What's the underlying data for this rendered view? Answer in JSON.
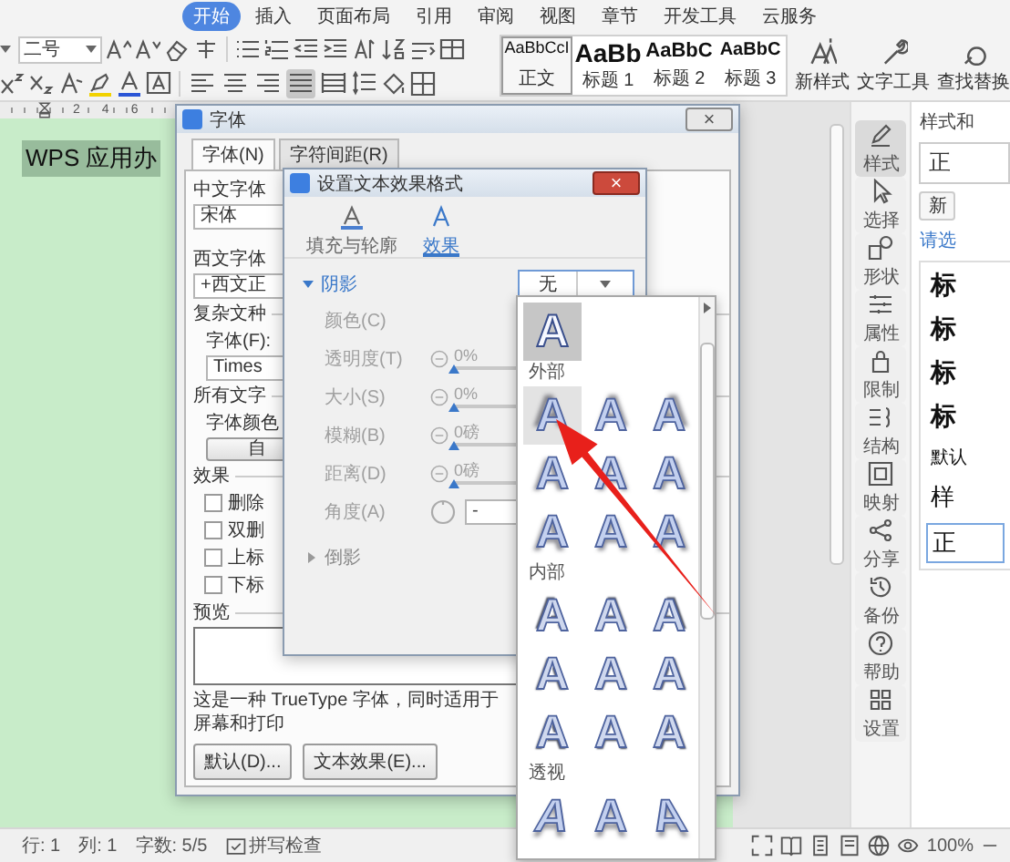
{
  "ribbon": {
    "tabs": [
      {
        "label": "开始",
        "selected": true
      },
      {
        "label": "插入",
        "selected": false
      },
      {
        "label": "页面布局",
        "selected": false
      },
      {
        "label": "引用",
        "selected": false
      },
      {
        "label": "审阅",
        "selected": false
      },
      {
        "label": "视图",
        "selected": false
      },
      {
        "label": "章节",
        "selected": false
      },
      {
        "label": "开发工具",
        "selected": false
      },
      {
        "label": "云服务",
        "selected": false
      }
    ],
    "font_size": "二号",
    "align_buttons": [
      {
        "selected": false
      },
      {
        "selected": false
      },
      {
        "selected": false
      },
      {
        "selected": true
      },
      {
        "selected": false
      }
    ],
    "styles": [
      {
        "sample": "AaBbCcI",
        "name": "正文",
        "kind": "normal",
        "selected": true
      },
      {
        "sample": "AaBb",
        "name": "标题 1",
        "kind": "heading1",
        "selected": false
      },
      {
        "sample": "AaBbC",
        "name": "标题 2",
        "kind": "heading2",
        "selected": false
      },
      {
        "sample": "AaBbC",
        "name": "标题 3",
        "kind": "heading3",
        "selected": false
      }
    ],
    "commands": [
      {
        "label": "新样式"
      },
      {
        "label": "文字工具"
      },
      {
        "label": "查找替换"
      }
    ]
  },
  "ruler": {
    "marks": [
      "2",
      "4",
      "6"
    ]
  },
  "document": {
    "text": "WPS 应用办",
    "selected": true
  },
  "font_dialog": {
    "title": "字体",
    "tabs": [
      {
        "label": "字体(N)",
        "selected": true
      },
      {
        "label": "字符间距(R)",
        "selected": false
      }
    ],
    "chinese_font": {
      "label": "中文字体",
      "value": "宋体"
    },
    "western_font": {
      "label": "西文字体",
      "value": "+西文正"
    },
    "complex_script": {
      "label": "复杂文种",
      "font_label": "字体(F):",
      "value": "Times"
    },
    "all_text": {
      "label": "所有文字",
      "color_label": "字体颜色",
      "color_button": "自"
    },
    "effects": {
      "label": "效果",
      "options": [
        {
          "label": "删除",
          "checked": false
        },
        {
          "label": "双删",
          "checked": false
        },
        {
          "label": "上标",
          "checked": false
        },
        {
          "label": "下标",
          "checked": false
        }
      ]
    },
    "preview_label": "预览",
    "description": "这是一种 TrueType 字体，同时适用于屏幕和打印",
    "buttons": [
      "默认(D)...",
      "文本效果(E)..."
    ]
  },
  "effect_dialog": {
    "title": "设置文本效果格式",
    "tabs": [
      {
        "label": "填充与轮廓",
        "selected": false
      },
      {
        "label": "效果",
        "selected": true
      }
    ],
    "shadow": {
      "label": "阴影",
      "expanded": true,
      "preset": "无",
      "rows": [
        {
          "kind": "color",
          "label": "颜色(C)",
          "disabled": true
        },
        {
          "kind": "slider",
          "label": "透明度(T)",
          "reading": "0%",
          "level": 0,
          "disabled": true
        },
        {
          "kind": "slider",
          "label": "大小(S)",
          "reading": "0%",
          "level": 0,
          "disabled": true
        },
        {
          "kind": "slider",
          "label": "模糊(B)",
          "reading": "0磅",
          "level": 0,
          "disabled": true
        },
        {
          "kind": "slider",
          "label": "距离(D)",
          "reading": "0磅",
          "level": 0,
          "disabled": true
        },
        {
          "kind": "angle",
          "label": "角度(A)",
          "value": "-",
          "disabled": true
        }
      ]
    },
    "reflection": {
      "label": "倒影",
      "expanded": false
    }
  },
  "shadow_menu": {
    "none": {
      "sample": "A",
      "selected": true
    },
    "groups": [
      {
        "heading": "外部",
        "kind": "outer",
        "presets": [
          {
            "sample": "A",
            "selected": false,
            "hovered": true
          },
          {
            "sample": "A",
            "selected": false,
            "hovered": false
          },
          {
            "sample": "A",
            "selected": false,
            "hovered": false
          },
          {
            "sample": "A",
            "selected": false,
            "hovered": false
          },
          {
            "sample": "A",
            "selected": false,
            "hovered": false
          },
          {
            "sample": "A",
            "selected": false,
            "hovered": false
          },
          {
            "sample": "A",
            "selected": false,
            "hovered": false
          },
          {
            "sample": "A",
            "selected": false,
            "hovered": false
          },
          {
            "sample": "A",
            "selected": false,
            "hovered": false
          }
        ]
      },
      {
        "heading": "内部",
        "kind": "inner",
        "presets": [
          {
            "sample": "A",
            "selected": false,
            "hovered": false
          },
          {
            "sample": "A",
            "selected": false,
            "hovered": false
          },
          {
            "sample": "A",
            "selected": false,
            "hovered": false
          },
          {
            "sample": "A",
            "selected": false,
            "hovered": false
          },
          {
            "sample": "A",
            "selected": false,
            "hovered": false
          },
          {
            "sample": "A",
            "selected": false,
            "hovered": false
          },
          {
            "sample": "A",
            "selected": false,
            "hovered": false
          },
          {
            "sample": "A",
            "selected": false,
            "hovered": false
          },
          {
            "sample": "A",
            "selected": false,
            "hovered": false
          }
        ]
      },
      {
        "heading": "透视",
        "kind": "perspective",
        "presets": [
          {
            "sample": "A",
            "selected": false,
            "hovered": false
          },
          {
            "sample": "A",
            "selected": false,
            "hovered": false
          },
          {
            "sample": "A",
            "selected": false,
            "hovered": false
          }
        ]
      }
    ]
  },
  "sidebar": {
    "items": [
      {
        "label": "样式",
        "selected": true
      },
      {
        "label": "选择",
        "selected": false
      },
      {
        "label": "形状",
        "selected": false
      },
      {
        "label": "属性",
        "selected": false
      },
      {
        "label": "限制",
        "selected": false
      },
      {
        "label": "结构",
        "selected": false
      },
      {
        "label": "映射",
        "selected": false
      },
      {
        "label": "分享",
        "selected": false
      },
      {
        "label": "备份",
        "selected": false
      },
      {
        "label": "帮助",
        "selected": false
      },
      {
        "label": "设置",
        "selected": false
      }
    ]
  },
  "styles_panel": {
    "title": "样式和",
    "current": "正",
    "new_button": "新",
    "prompt": "请选",
    "entries": [
      {
        "label": "标",
        "kind": "heading",
        "selected": false
      },
      {
        "label": "标",
        "kind": "heading",
        "selected": false
      },
      {
        "label": "标",
        "kind": "heading",
        "selected": false
      },
      {
        "label": "标",
        "kind": "heading",
        "selected": false
      },
      {
        "label": "默认",
        "kind": "plain",
        "selected": false
      },
      {
        "label": "样",
        "kind": "large",
        "selected": false
      },
      {
        "label": "正",
        "kind": "large",
        "selected": true
      }
    ]
  },
  "status_bar": {
    "items": [
      "行: 1",
      "列: 1",
      "字数: 5/5"
    ],
    "spell_check": "拼写检查",
    "zoom": "100%"
  }
}
